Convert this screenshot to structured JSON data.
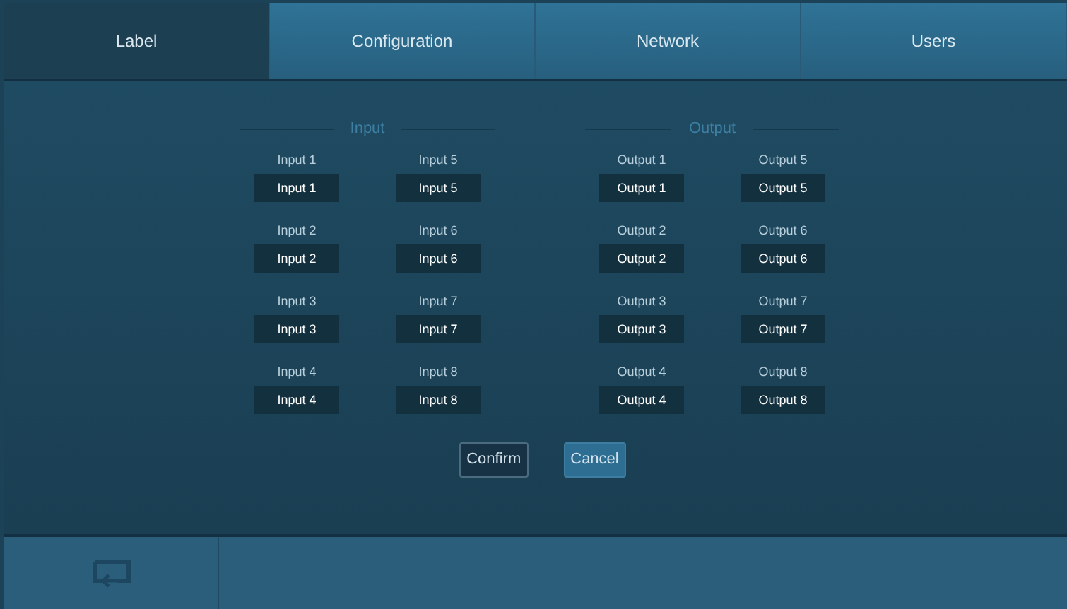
{
  "tabs": [
    {
      "label": "Label",
      "selected": true
    },
    {
      "label": "Configuration",
      "selected": false
    },
    {
      "label": "Network",
      "selected": false
    },
    {
      "label": "Users",
      "selected": false
    }
  ],
  "sections": [
    {
      "title": "Input",
      "fields": [
        {
          "label": "Input 1",
          "value": "Input 1"
        },
        {
          "label": "Input 2",
          "value": "Input 2"
        },
        {
          "label": "Input 3",
          "value": "Input 3"
        },
        {
          "label": "Input 4",
          "value": "Input 4"
        },
        {
          "label": "Input 5",
          "value": "Input 5"
        },
        {
          "label": "Input 6",
          "value": "Input 6"
        },
        {
          "label": "Input 7",
          "value": "Input 7"
        },
        {
          "label": "Input 8",
          "value": "Input 8"
        }
      ]
    },
    {
      "title": "Output",
      "fields": [
        {
          "label": "Output 1",
          "value": "Output 1"
        },
        {
          "label": "Output 2",
          "value": "Output 2"
        },
        {
          "label": "Output 3",
          "value": "Output 3"
        },
        {
          "label": "Output 4",
          "value": "Output 4"
        },
        {
          "label": "Output 5",
          "value": "Output 5"
        },
        {
          "label": "Output 6",
          "value": "Output 6"
        },
        {
          "label": "Output 7",
          "value": "Output 7"
        },
        {
          "label": "Output 8",
          "value": "Output 8"
        }
      ]
    }
  ],
  "buttons": [
    {
      "label": "Confirm",
      "kind": "dark"
    },
    {
      "label": "Cancel",
      "kind": "light"
    }
  ]
}
